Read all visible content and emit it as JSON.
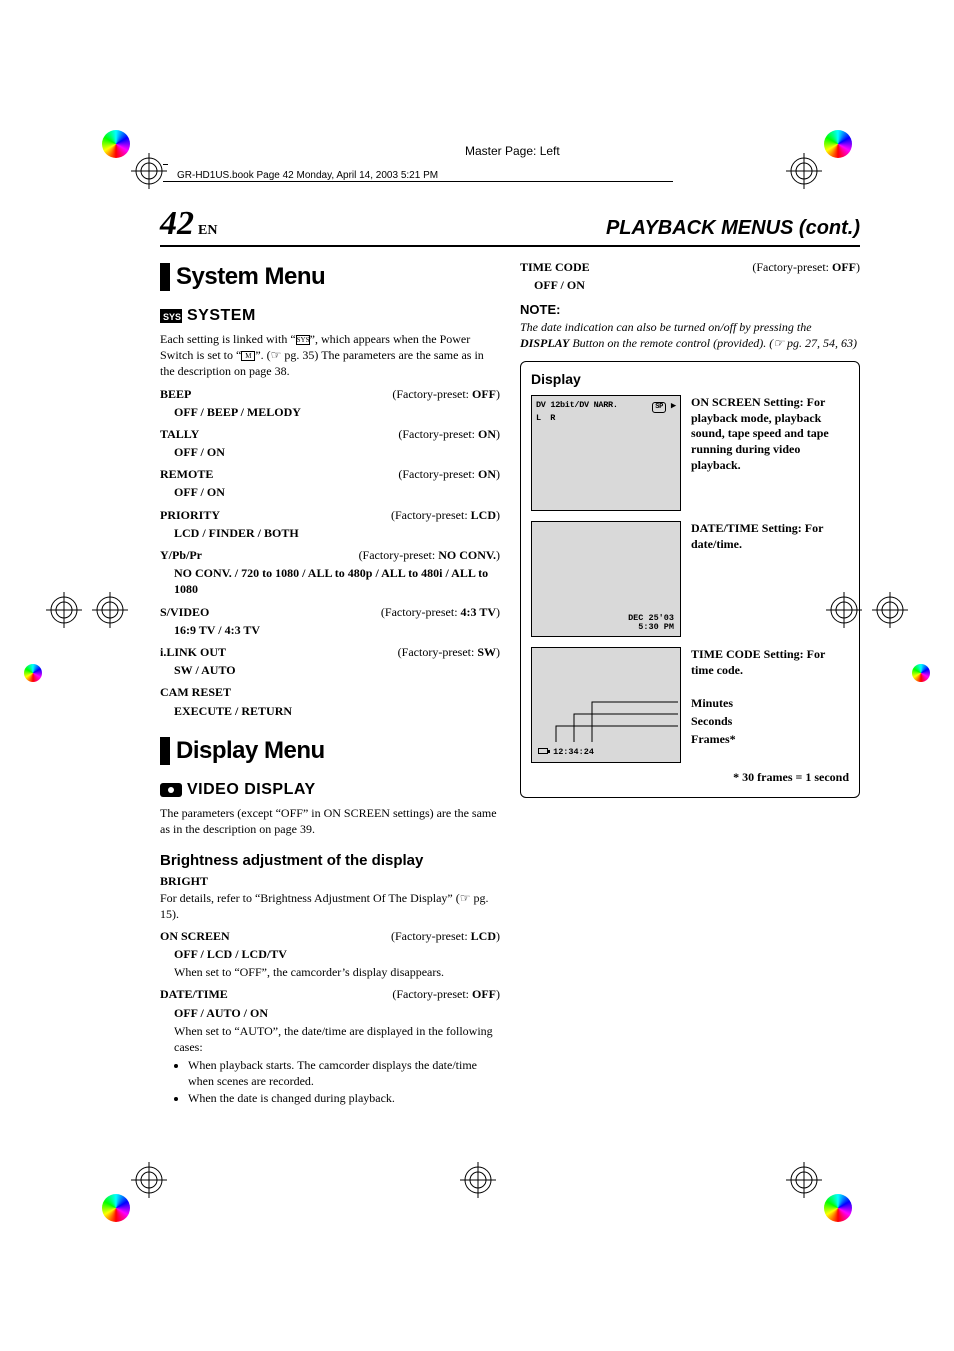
{
  "masterPage": "Master Page: Left",
  "bookInfo": "GR-HD1US.book  Page 42  Monday, April 14, 2003  5:21 PM",
  "header": {
    "pageNum": "42",
    "lang": "EN",
    "sectionTitle": "PLAYBACK MENUS (cont.)"
  },
  "left": {
    "systemMenu": "System Menu",
    "systemSub": "SYSTEM",
    "systemIntro1": "Each setting is linked with “",
    "systemIntro2": "”, which appears when the Power Switch is set to “",
    "systemIntro3": "”. (☞ pg. 35) The parameters are the same as in the description on page 38.",
    "settings": [
      {
        "name": "BEEP",
        "preset": "(Factory-preset: OFF)",
        "opts": "OFF / BEEP / MELODY"
      },
      {
        "name": "TALLY",
        "preset": "(Factory-preset: ON)",
        "opts": "OFF / ON"
      },
      {
        "name": "REMOTE",
        "preset": "(Factory-preset: ON)",
        "opts": "OFF / ON"
      },
      {
        "name": "PRIORITY",
        "preset": "(Factory-preset: LCD)",
        "opts": "LCD / FINDER / BOTH"
      },
      {
        "name": "Y/Pb/Pr",
        "preset": "(Factory-preset: NO CONV.)",
        "opts": "NO CONV. / 720 to 1080 / ALL to 480p / ALL to 480i / ALL to 1080"
      },
      {
        "name": "S/VIDEO",
        "preset": "(Factory-preset: 4:3 TV)",
        "opts": "16:9 TV / 4:3 TV"
      },
      {
        "name": "i.LINK OUT",
        "preset": "(Factory-preset: SW)",
        "opts": "SW / AUTO"
      },
      {
        "name": "CAM RESET",
        "preset": "",
        "opts": "EXECUTE / RETURN"
      }
    ],
    "displayMenu": "Display Menu",
    "videoDisplay": "VIDEO DISPLAY",
    "videoPara": "The parameters (except “OFF” in ON SCREEN settings) are the same as in the description on page 39.",
    "brightHeading": "Brightness adjustment of the display",
    "brightName": "BRIGHT",
    "brightPara": "For details, refer to “Brightness Adjustment Of The Display” (☞ pg. 15).",
    "onScreen": {
      "name": "ON SCREEN",
      "preset": "(Factory-preset: LCD)",
      "opts": "OFF / LCD / LCD/TV",
      "desc": "When set to “OFF”, the camcorder’s display disappears."
    },
    "dateTime": {
      "name": "DATE/TIME",
      "preset": "(Factory-preset: OFF)",
      "opts": "OFF / AUTO / ON",
      "desc": "When set to “AUTO”, the date/time are displayed in the following cases:",
      "bullets": [
        "When playback starts. The camcorder displays the date/time when scenes are recorded.",
        "When the date is changed during playback."
      ]
    }
  },
  "right": {
    "timeCode": {
      "name": "TIME CODE",
      "preset": "(Factory-preset: OFF)",
      "opts": "OFF / ON"
    },
    "noteLabel": "NOTE:",
    "noteText1": "The date indication can also be turned on/off by pressing the ",
    "noteDisplay": "DISPLAY",
    "noteText2": " Button on the remote control (provided). (☞ pg. 27, 54, 63)",
    "displayBox": {
      "title": "Display",
      "screen1": {
        "top": "DV 12bit/DV NARR.",
        "sp": "SP",
        "lr": "L R",
        "desc": "ON SCREEN Setting: For playback mode, playback sound, tape speed and tape running during video playback."
      },
      "screen2": {
        "date": "DEC 25'03",
        "time": "5:30 PM",
        "desc": "DATE/TIME Setting: For date/time."
      },
      "screen3": {
        "tc": "12:34:24",
        "desc": "TIME CODE Setting: For time code.",
        "minutes": "Minutes",
        "seconds": "Seconds",
        "frames": "Frames*"
      },
      "footer": "* 30 frames = 1 second"
    }
  }
}
